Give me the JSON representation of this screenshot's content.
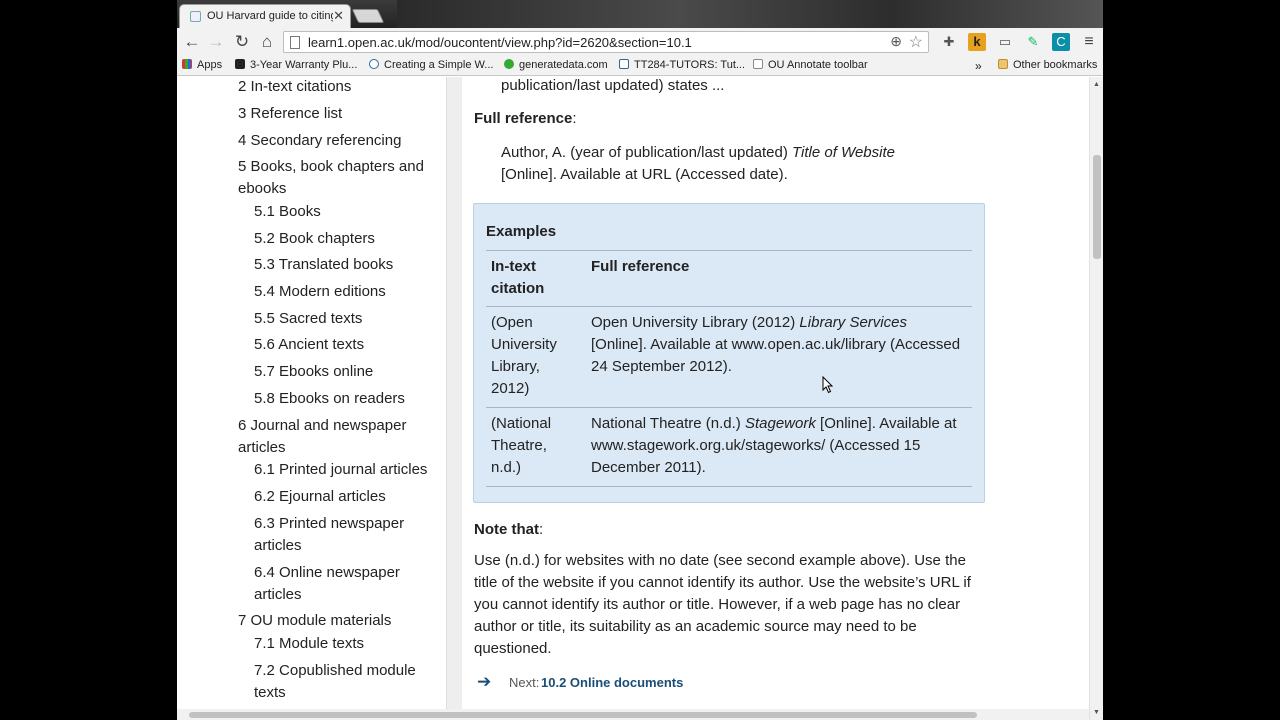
{
  "tab": {
    "title": "OU Harvard guide to citing",
    "close": "✕"
  },
  "toolbar": {
    "back": "←",
    "forward": "→",
    "reload": "↻",
    "home": "⌂",
    "url": "learn1.open.ac.uk/mod/oucontent/view.php?id=2620&section=10.1",
    "zoom_icon": "⊕",
    "star_icon": "☆",
    "menu_icon": "≡",
    "ext_icons": [
      "puzzle-icon",
      "k-icon",
      "cast-icon",
      "pen-icon",
      "c-icon"
    ]
  },
  "bookmarks": {
    "items": [
      "Apps",
      "3-Year Warranty Plu...",
      "Creating a Simple W...",
      "generatedata.com",
      "TT284-TUTORS: Tut...",
      "OU Annotate toolbar"
    ],
    "more": "»",
    "other": "Other bookmarks"
  },
  "sidebar": {
    "items": [
      "2 In-text citations",
      "3 Reference list",
      "4 Secondary referencing",
      "5 Books, book chapters and ebooks",
      "5.1 Books",
      "5.2 Book chapters",
      "5.3 Translated books",
      "5.4 Modern editions",
      "5.5 Sacred texts",
      "5.6 Ancient texts",
      "5.7 Ebooks online",
      "5.8 Ebooks on readers",
      "6 Journal and newspaper articles",
      "6.1 Printed journal articles",
      "6.2 Ejournal articles",
      "6.3 Printed newspaper articles",
      "6.4 Online newspaper articles",
      "7 OU module materials",
      "7.1 Module texts",
      "7.2 Copublished module texts"
    ]
  },
  "main": {
    "intro_tail": "publication/last updated) states ...",
    "full_ref_label": "Full reference",
    "colon": ":",
    "ref_format_1": "Author, A. (year of publication/last updated) ",
    "ref_format_title": "Title of Website",
    "ref_format_2": "[Online]. Available at URL (Accessed date).",
    "examples": {
      "heading": "Examples",
      "col1": "In-text citation",
      "col2": "Full reference",
      "rows": [
        {
          "cite": "(Open University Library, 2012)",
          "ref_a": "Open University Library (2012) ",
          "ref_title": "Library Services",
          "ref_b": "[Online]. Available at www.open.ac.uk/library (Accessed 24 September 2012)."
        },
        {
          "cite": "(National Theatre, n.d.)",
          "ref_a": "National Theatre (n.d.) ",
          "ref_title": "Stagework",
          "ref_b": " [Online]. Available at www.stagework.org.uk/stageworks/ (Accessed 15 December 2011)."
        }
      ]
    },
    "note_label": "Note that",
    "note_text": "Use (n.d.) for websites with no date (see second example above). Use the title of the website if you cannot identify its author. Use the website’s URL if you cannot identify its author or title. However, if a web page has no clear author or title, its suitability as an academic source may need to be questioned.",
    "next_label": "Next:",
    "next_target": "10.2 Online documents",
    "next_arrow": "➔"
  }
}
